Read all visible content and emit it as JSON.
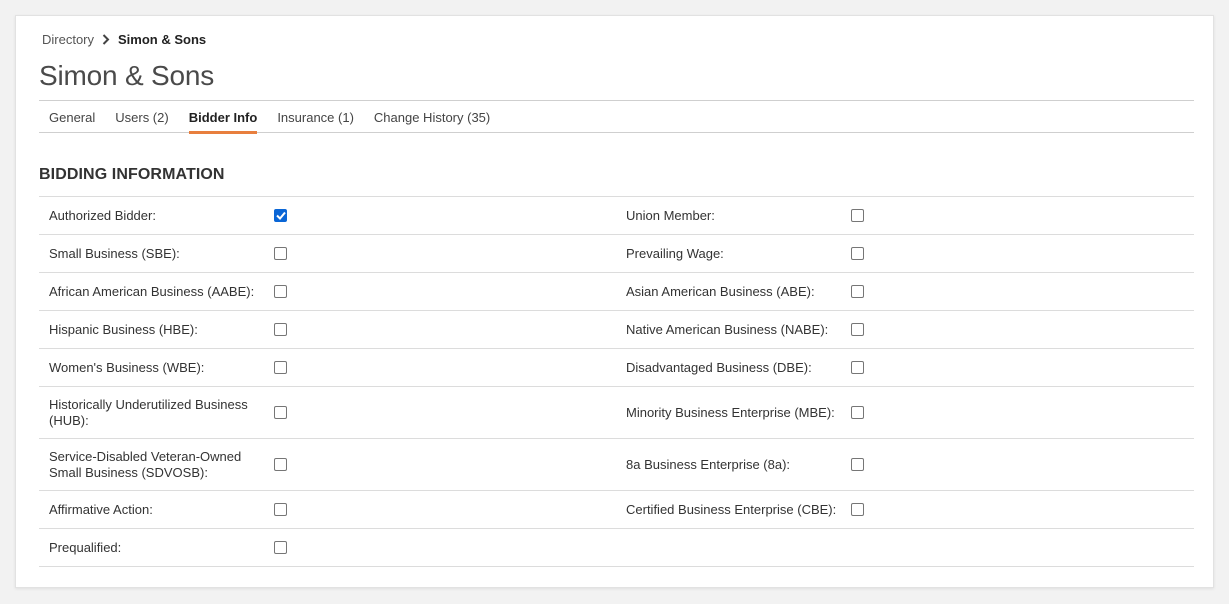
{
  "breadcrumb": {
    "parent": "Directory",
    "current": "Simon & Sons"
  },
  "page_title": "Simon & Sons",
  "tabs": [
    {
      "label": "General",
      "active": false
    },
    {
      "label": "Users (2)",
      "active": false
    },
    {
      "label": "Bidder Info",
      "active": true
    },
    {
      "label": "Insurance (1)",
      "active": false
    },
    {
      "label": "Change History (35)",
      "active": false
    }
  ],
  "section_title": "BIDDING INFORMATION",
  "accent_color": "#e87f3e",
  "rows": [
    {
      "left": {
        "label": "Authorized Bidder:",
        "checked": true
      },
      "right": {
        "label": "Union Member:",
        "checked": false
      }
    },
    {
      "left": {
        "label": "Small Business (SBE):",
        "checked": false
      },
      "right": {
        "label": "Prevailing Wage:",
        "checked": false
      }
    },
    {
      "left": {
        "label": "African American Business (AABE):",
        "checked": false
      },
      "right": {
        "label": "Asian American Business (ABE):",
        "checked": false
      }
    },
    {
      "left": {
        "label": "Hispanic Business (HBE):",
        "checked": false
      },
      "right": {
        "label": "Native American Business (NABE):",
        "checked": false
      }
    },
    {
      "left": {
        "label": "Women's Business (WBE):",
        "checked": false
      },
      "right": {
        "label": "Disadvantaged Business (DBE):",
        "checked": false
      }
    },
    {
      "left": {
        "label": "Historically Underutilized Business (HUB):",
        "checked": false
      },
      "right": {
        "label": "Minority Business Enterprise (MBE):",
        "checked": false
      }
    },
    {
      "left": {
        "label": "Service-Disabled Veteran-Owned Small Business (SDVOSB):",
        "checked": false
      },
      "right": {
        "label": "8a Business Enterprise (8a):",
        "checked": false
      }
    },
    {
      "left": {
        "label": "Affirmative Action:",
        "checked": false
      },
      "right": {
        "label": "Certified Business Enterprise (CBE):",
        "checked": false
      }
    },
    {
      "left": {
        "label": "Prequalified:",
        "checked": false
      },
      "right": null
    }
  ]
}
